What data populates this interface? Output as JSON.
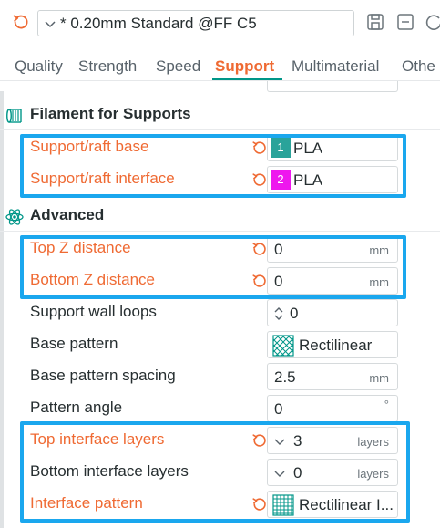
{
  "toolbar": {
    "preset_name": "* 0.20mm Standard @FF C5",
    "icons": [
      "reset-arrow-icon",
      "chevron-down-icon",
      "save-icon",
      "minimize-icon",
      "refresh-icon"
    ]
  },
  "tabs": [
    {
      "label": "Quality",
      "active": false
    },
    {
      "label": "Strength",
      "active": false
    },
    {
      "label": "Speed",
      "active": false
    },
    {
      "label": "Support",
      "active": true
    },
    {
      "label": "Multimaterial",
      "active": false
    },
    {
      "label": "Othe",
      "active": false
    }
  ],
  "filament_section": {
    "title": "Filament for Supports",
    "rows": [
      {
        "label": "Support/raft base",
        "slot": "1",
        "slot_color": "#2aa39a",
        "filament": "PLA",
        "modified": true
      },
      {
        "label": "Support/raft interface",
        "slot": "2",
        "slot_color": "#ee17ee",
        "filament": "PLA",
        "modified": true
      }
    ]
  },
  "advanced_section": {
    "title": "Advanced",
    "rows": [
      {
        "label": "Top Z distance",
        "value": "0",
        "unit": "mm",
        "modified": true
      },
      {
        "label": "Bottom Z distance",
        "value": "0",
        "unit": "mm",
        "modified": true
      },
      {
        "label": "Support wall loops",
        "value": "0",
        "modified": false
      },
      {
        "label": "Base pattern",
        "value": "Rectilinear",
        "modified": false
      },
      {
        "label": "Base pattern spacing",
        "value": "2.5",
        "unit": "mm",
        "modified": false
      },
      {
        "label": "Pattern angle",
        "value": "0",
        "unit": "°",
        "modified": false
      },
      {
        "label": "Top interface layers",
        "value": "3",
        "unit": "layers",
        "modified": true
      },
      {
        "label": "Bottom interface layers",
        "value": "0",
        "unit": "layers",
        "modified": false
      },
      {
        "label": "Interface pattern",
        "value": "Rectilinear I...",
        "modified": true
      }
    ]
  },
  "colors": {
    "accent_orange": "#ef6a33",
    "tab_underline": "#009688",
    "highlight_blue": "#1aa7ee"
  }
}
